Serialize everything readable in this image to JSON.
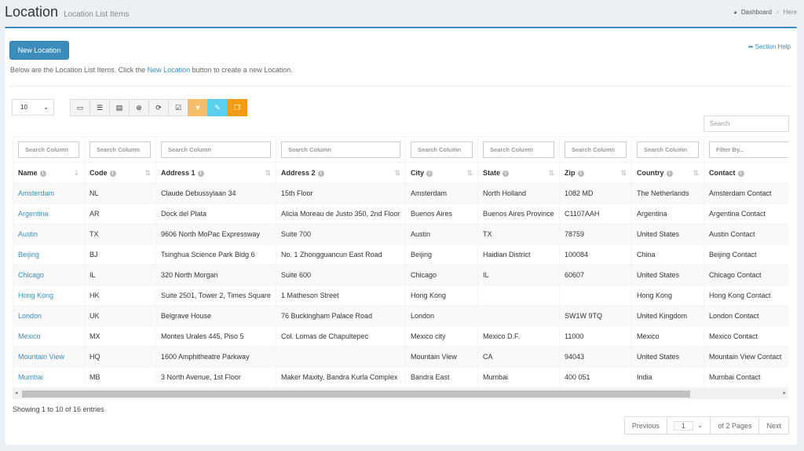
{
  "header": {
    "title": "Location",
    "subtitle": "Location List Items"
  },
  "breadcrumb": {
    "dashboard": "Dashboard",
    "sep": ">",
    "here": "Here"
  },
  "actions": {
    "new_label": "New Location",
    "help_label": "Section Help"
  },
  "description": {
    "before": "Below are the Location List Items. Click the ",
    "link": "New Location",
    "after": " button to create a new Location."
  },
  "page_length": "10",
  "search_placeholder": "Search",
  "column_filters": [
    "Search Column",
    "Search Column",
    "Search Column",
    "Search Column",
    "Search Column",
    "Search Column",
    "Search Column",
    "Search Column",
    "Filter By..."
  ],
  "columns": [
    "Name",
    "Code",
    "Address 1",
    "Address 2",
    "City",
    "State",
    "Zip",
    "Country",
    "Contact"
  ],
  "rows": [
    [
      "Amsterdam",
      "NL",
      "Claude Debussylaan 34",
      "15th Floor",
      "Amsterdam",
      "North Holland",
      "1082 MD",
      "The Netherlands",
      "Amsterdam Contact"
    ],
    [
      "Argentina",
      "AR",
      "Dock del Plata",
      "Alicia Moreau de Justo 350, 2nd Floor",
      "Buenos Aires",
      "Buenos Aires Province",
      "C1107AAH",
      "Argentina",
      "Argentina Contact"
    ],
    [
      "Austin",
      "TX",
      "9606 North MoPac Expressway",
      "Suite 700",
      "Austin",
      "TX",
      "78759",
      "United States",
      "Austin Contact"
    ],
    [
      "Beijing",
      "BJ",
      "Tsinghua Science Park Bldg 6",
      "No. 1 Zhongguancun East Road",
      "Beijing",
      "Haidian District",
      "100084",
      "China",
      "Beijing Contact"
    ],
    [
      "Chicago",
      "IL",
      "320 North Morgan",
      "Suite 600",
      "Chicago",
      "IL",
      "60607",
      "United States",
      "Chicago Contact"
    ],
    [
      "Hong Kong",
      "HK",
      "Suite 2501, Tower 2, Times Square",
      "1 Matheson Street",
      "Hong Kong",
      "",
      "",
      "Hong Kong",
      "Hong Kong Contact"
    ],
    [
      "London",
      "UK",
      "Belgrave House",
      "76 Buckingham Palace Road",
      "London",
      "",
      "SW1W 9TQ",
      "United Kingdom",
      "London Contact"
    ],
    [
      "Mexico",
      "MX",
      "Montes Urales 445, Piso 5",
      "Col. Lomas de Chapultepec",
      "Mexico city",
      "Mexico D.F.",
      "11000",
      "Mexico",
      "Mexico Contact"
    ],
    [
      "Mountain View",
      "HQ",
      "1600 Amphitheatre Parkway",
      "",
      "Mountain View",
      "CA",
      "94043",
      "United States",
      "Mountain View Contact"
    ],
    [
      "Mumbai",
      "MB",
      "3 North Avenue, 1st Floor",
      "Maker Maxity, Bandra Kurla Complex",
      "Bandra East",
      "Mumbai",
      "400 051",
      "India",
      "Mumbai Contact"
    ]
  ],
  "info": "Showing 1 to 10 of 16 entries",
  "pagination": {
    "previous": "Previous",
    "page": "1",
    "of_pages": "of 2 Pages",
    "next": "Next"
  },
  "colors": {
    "accent": "#3c8dbc",
    "warning": "#f39c12",
    "info": "#5bd0ee"
  }
}
